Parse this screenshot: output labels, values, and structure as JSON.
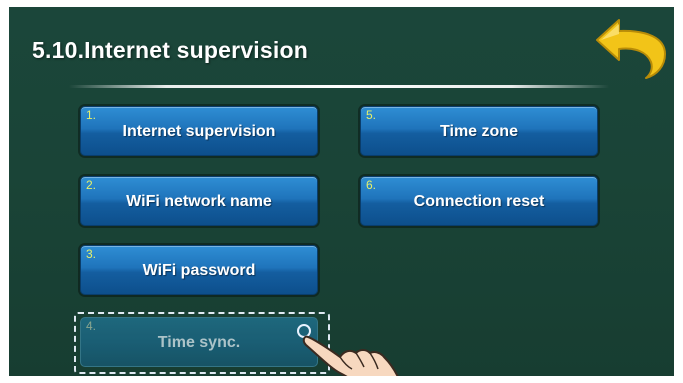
{
  "header": {
    "title": "5.10.Internet supervision"
  },
  "menu": {
    "items": [
      {
        "number": "1.",
        "label": "Internet supervision"
      },
      {
        "number": "2.",
        "label": "WiFi network name"
      },
      {
        "number": "3.",
        "label": "WiFi password"
      },
      {
        "number": "4.",
        "label": "Time sync."
      },
      {
        "number": "5.",
        "label": "Time zone"
      },
      {
        "number": "6.",
        "label": "Connection reset"
      }
    ],
    "selected_item": "Time sync."
  },
  "icons": {
    "back": "back-arrow-icon",
    "pointer": "hand-pointer-icon"
  },
  "colors": {
    "background": "#1a4437",
    "button": "#1f74bb",
    "number_text": "#e6f06a",
    "back_arrow": "#f2c418"
  }
}
